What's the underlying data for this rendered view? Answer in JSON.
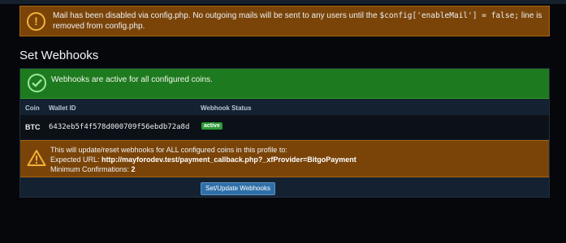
{
  "mail_alert": {
    "text_before": "Mail has been disabled via config.php. No outgoing mails will be sent to any users until the",
    "code": "$config['enableMail'] = false;",
    "text_after": "line is removed from config.php."
  },
  "section": {
    "title": "Set Webhooks"
  },
  "success": {
    "text": "Webhooks are active for all configured coins."
  },
  "table": {
    "headers": {
      "coin": "Coin",
      "wallet": "Wallet ID",
      "status": "Webhook Status"
    },
    "rows": [
      {
        "coin": "BTC",
        "wallet": "6432eb5f4f578d000709f56ebdb72a8d",
        "status": "active"
      }
    ]
  },
  "warning": {
    "line1": "This will update/reset webhooks for ALL configured coins in this profile to:",
    "url_label": "Expected URL:",
    "url": "http://mayforodev.test/payment_callback.php?_xfProvider=BitgoPayment",
    "conf_label": "Minimum Confirmations:",
    "conf_value": "2"
  },
  "button": {
    "label": "Set/Update Webhooks"
  },
  "colors": {
    "warning": "#7a4409",
    "success": "#1e7a1e",
    "button": "#2f6fa8"
  },
  "icons": {
    "mail_alert": "warning-circle-icon",
    "success": "check-circle-icon",
    "warning": "warning-triangle-icon"
  }
}
